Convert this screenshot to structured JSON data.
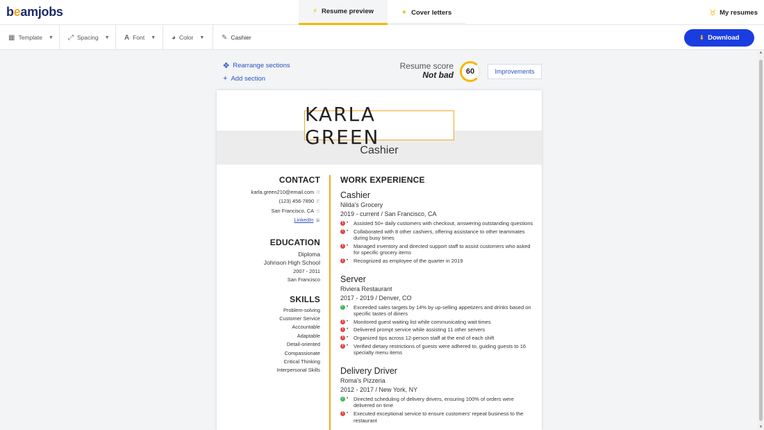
{
  "header": {
    "logo_text": "beamjobs",
    "tabs": [
      {
        "label": "Resume preview",
        "icon": "lightning-icon"
      },
      {
        "label": "Cover letters",
        "icon": "sparkle-icon"
      }
    ],
    "my_resumes": "My resumes"
  },
  "toolbar": {
    "template": "Template",
    "spacing": "Spacing",
    "font": "Font",
    "color": "Color",
    "resume_name": "Cashier",
    "download": "Download"
  },
  "actions": {
    "rearrange": "Rearrange sections",
    "add": "Add section"
  },
  "score": {
    "label": "Resume score",
    "rating": "Not bad",
    "value": "60",
    "improvements": "Improvements"
  },
  "resume": {
    "name": "KARLA GREEN",
    "title": "Cashier",
    "contact": {
      "heading": "CONTACT",
      "email": "karla.green210@email.com",
      "phone": "(123) 456-7890",
      "location": "San Francisco, CA",
      "linkedin": "LinkedIn"
    },
    "education": {
      "heading": "EDUCATION",
      "degree": "Diploma",
      "school": "Johnson High School",
      "dates": "2007 - 2011",
      "location": "San Francisco"
    },
    "skills": {
      "heading": "SKILLS",
      "items": [
        "Problem-solving",
        "Customer Service",
        "Accountable",
        "Adaptable",
        "Detail-oriented",
        "Compassionate",
        "Critical Thinking",
        "Interpersonal Skills"
      ]
    },
    "experience": {
      "heading": "WORK EXPERIENCE",
      "jobs": [
        {
          "title": "Cashier",
          "company": "Nilda's Grocery",
          "dates": "2019 - current  /  San Francisco, CA",
          "bullets": [
            {
              "status": "red",
              "text": "Assisted 50+ daily customers with checkout, answering outstanding questions"
            },
            {
              "status": "red",
              "text": "Collaborated with 8 other cashiers, offering assistance to other teammates during busy times"
            },
            {
              "status": "red",
              "text": "Managed inventory and directed support staff to assist customers who asked for specific grocery items"
            },
            {
              "status": "red",
              "text": "Recognized as employee of the quarter in 2019"
            }
          ]
        },
        {
          "title": "Server",
          "company": "Riviera Restaurant",
          "dates": "2017 - 2019  /  Denver, CO",
          "bullets": [
            {
              "status": "green",
              "text": "Exceeded sales targets by 14% by up-selling appetizers and drinks based on specific tastes of diners"
            },
            {
              "status": "red",
              "text": "Monitored guest waiting list while communicating wait times"
            },
            {
              "status": "red",
              "text": "Delivered prompt service while assisting 11 other servers"
            },
            {
              "status": "red",
              "text": "Organized tips across 12-person staff at the end of each shift"
            },
            {
              "status": "red",
              "text": "Verified dietary restrictions of guests were adhered to, guiding guests to 16 specialty menu items"
            }
          ]
        },
        {
          "title": "Delivery Driver",
          "company": "Roma's Pizzeria",
          "dates": "2012 - 2017  /  New York, NY",
          "bullets": [
            {
              "status": "green",
              "text": "Directed scheduling of delivery drivers, ensuring 100% of orders were delivered on time"
            },
            {
              "status": "red",
              "text": "Executed exceptional service to ensure customers' repeat business to the restaurant"
            }
          ]
        }
      ]
    }
  },
  "colors": {
    "brand_blue": "#1a3de0",
    "accent_yellow": "#f5b800",
    "accent_orange": "#f5a623",
    "status_red": "#e04848",
    "status_green": "#3fb75c"
  }
}
